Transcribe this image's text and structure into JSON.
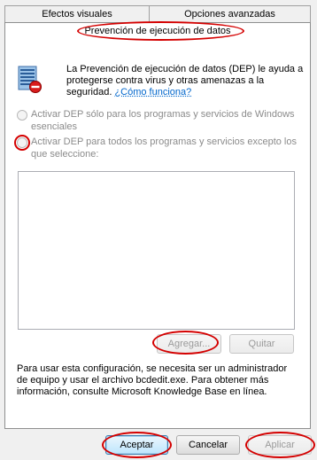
{
  "tabs": [
    {
      "label": "Efectos visuales"
    },
    {
      "label": "Opciones avanzadas"
    },
    {
      "label": "Prevención de ejecución de datos"
    }
  ],
  "intro": {
    "line1": "La Prevención de ejecución de datos (DEP) le ayuda a",
    "line2": "protegerse contra virus y otras amenazas a la",
    "line3_prefix": "seguridad. ",
    "link": "¿Cómo funciona?"
  },
  "options": {
    "essential_line1": "Activar DEP sólo para los programas y servicios de Windows",
    "essential_line2": "esenciales",
    "all_line1": "Activar DEP para todos los programas y servicios excepto los",
    "all_line2": "que seleccione:"
  },
  "buttons": {
    "add": "Agregar...",
    "remove": "Quitar",
    "ok": "Aceptar",
    "cancel": "Cancelar",
    "apply": "Aplicar"
  },
  "footer": {
    "line1": "Para usar esta configuración, se necesita ser un administrador",
    "line2": "de equipo y usar el archivo bcdedit.exe. Para obtener más",
    "line3": "información, consulte Microsoft Knowledge Base en línea."
  },
  "colors": {
    "annotation": "#d40000",
    "link": "#0066cc"
  },
  "icons": {
    "dep": "dep-shield-icon"
  }
}
